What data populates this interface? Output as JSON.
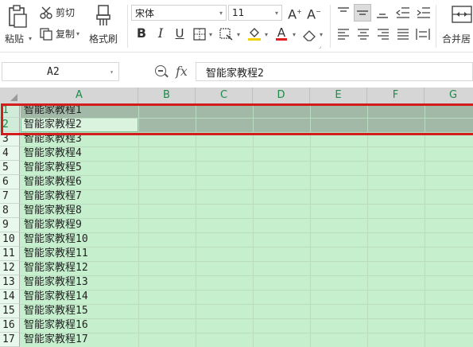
{
  "ribbon": {
    "paste_label": "粘贴",
    "cut_label": "剪切",
    "copy_label": "复制",
    "format_painter_label": "格式刷",
    "font_name": "宋体",
    "font_size": "11",
    "merge_label": "合并居"
  },
  "formula_bar": {
    "name_box": "A2",
    "formula": "智能家教程2"
  },
  "columns": [
    "A",
    "B",
    "C",
    "D",
    "E",
    "F",
    "G"
  ],
  "rows": [
    {
      "num": "1",
      "a": "智能家教程1"
    },
    {
      "num": "2",
      "a": "智能家教程2"
    },
    {
      "num": "3",
      "a": "智能家教程3"
    },
    {
      "num": "4",
      "a": "智能家教程4"
    },
    {
      "num": "5",
      "a": "智能家教程5"
    },
    {
      "num": "6",
      "a": "智能家教程6"
    },
    {
      "num": "7",
      "a": "智能家教程7"
    },
    {
      "num": "8",
      "a": "智能家教程8"
    },
    {
      "num": "9",
      "a": "智能家教程9"
    },
    {
      "num": "10",
      "a": "智能家教程10"
    },
    {
      "num": "11",
      "a": "智能家教程11"
    },
    {
      "num": "12",
      "a": "智能家教程12"
    },
    {
      "num": "13",
      "a": "智能家教程13"
    },
    {
      "num": "14",
      "a": "智能家教程14"
    },
    {
      "num": "15",
      "a": "智能家教程15"
    },
    {
      "num": "16",
      "a": "智能家教程16"
    },
    {
      "num": "17",
      "a": "智能家教程17"
    }
  ],
  "colors": {
    "cell_fill": "#c6efce",
    "selection_fill": "#a3b9a8",
    "highlight_border": "#d31d1d",
    "active_header_text": "#1e8a4a",
    "font_color_bar": "#e02020",
    "fill_color_bar": "#f5d000"
  },
  "icons": [
    "paste-icon",
    "scissors-icon",
    "copy-icon",
    "format-painter-icon",
    "font-grow-icon",
    "font-shrink-icon",
    "bold-icon",
    "italic-icon",
    "underline-icon",
    "border-icon",
    "clear-format-icon",
    "fill-color-icon",
    "font-color-icon",
    "eraser-icon",
    "align-top-icon",
    "align-middle-icon",
    "align-bottom-icon",
    "indent-decrease-icon",
    "indent-increase-icon",
    "align-left-icon",
    "align-center-icon",
    "align-right-icon",
    "justify-icon",
    "distributed-icon",
    "merge-icon",
    "zoom-icon"
  ]
}
